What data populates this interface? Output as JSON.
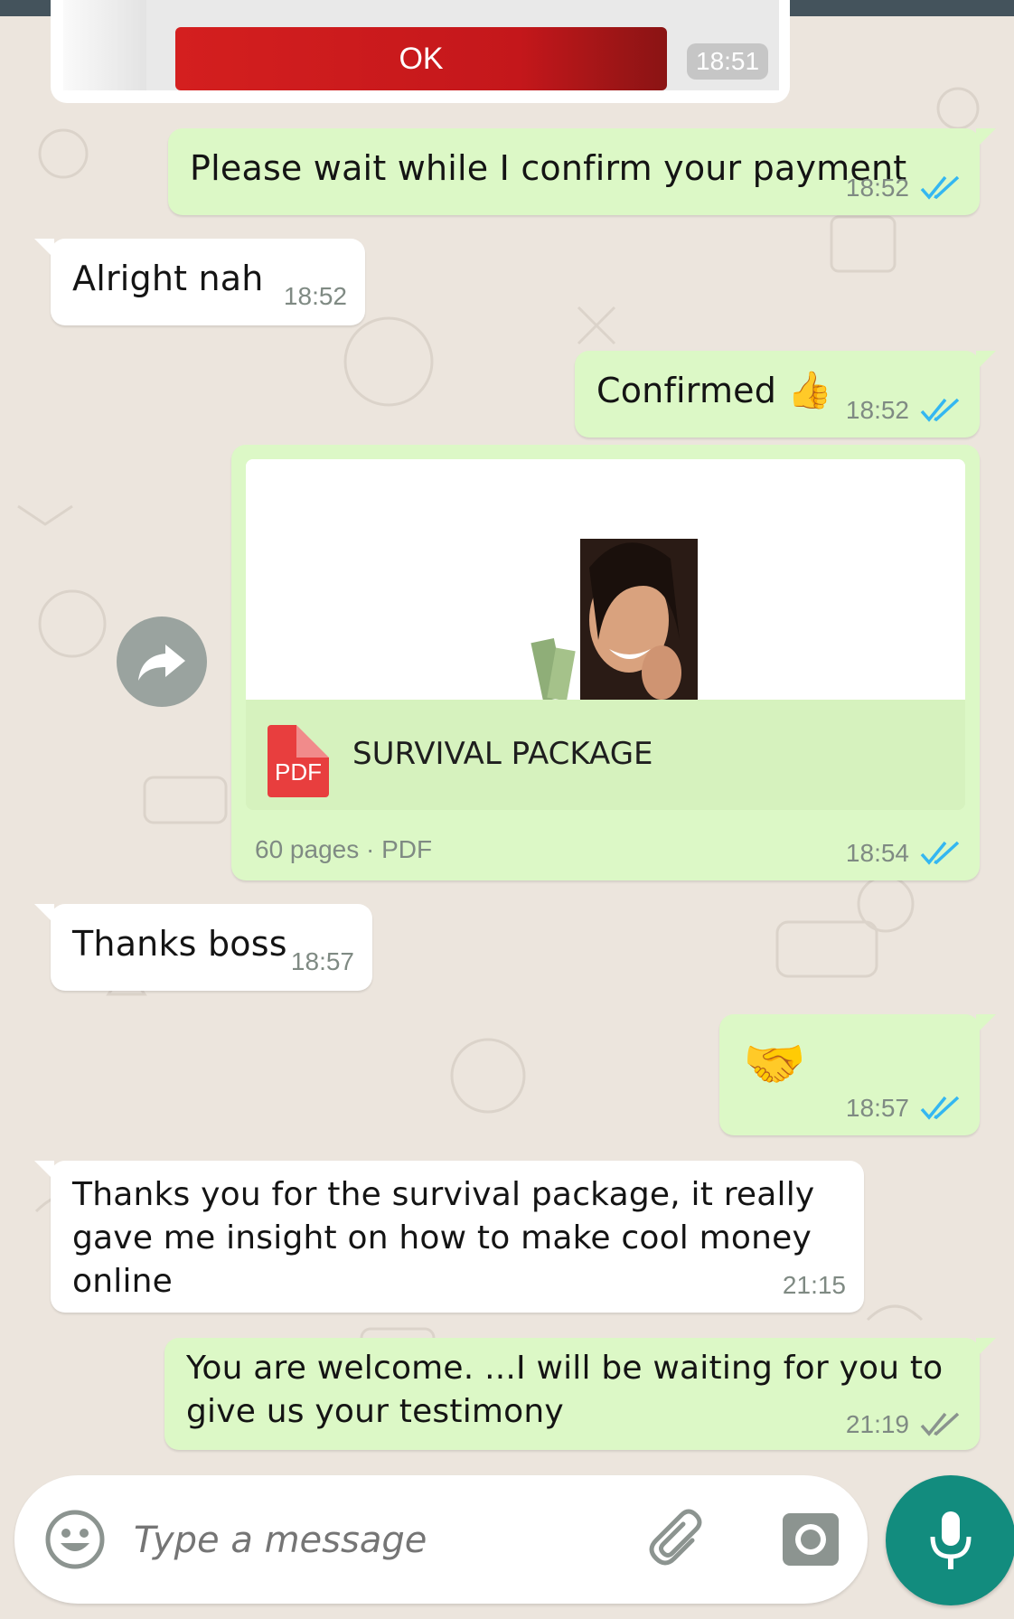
{
  "top_card": {
    "button_label": "OK",
    "time": "18:51"
  },
  "messages": [
    {
      "direction": "out",
      "text": "Please wait while I confirm your payment",
      "time": "18:52",
      "status": "read"
    },
    {
      "direction": "in",
      "text": "Alright nah",
      "time": "18:52"
    },
    {
      "direction": "out",
      "text": "Confirmed",
      "emoji": "👍",
      "time": "18:52",
      "status": "read"
    },
    {
      "direction": "out",
      "type": "document",
      "doc_name": "SURVIVAL PACKAGE",
      "doc_icon_label": "PDF",
      "doc_info": "60 pages · PDF",
      "time": "18:54",
      "status": "read"
    },
    {
      "direction": "in",
      "text": "Thanks boss",
      "time": "18:57"
    },
    {
      "direction": "out",
      "emoji": "🤝",
      "time": "18:57",
      "status": "read"
    },
    {
      "direction": "in",
      "text_lines": [
        "Thanks you for the survival package, it really",
        "gave me insight on how to make cool money online"
      ],
      "time": "21:15"
    },
    {
      "direction": "out",
      "text_lines": [
        "You are welcome. ...I will be waiting for you to",
        "give us your testimony"
      ],
      "time": "21:19",
      "status": "delivered"
    }
  ],
  "composer": {
    "placeholder": "Type a message"
  },
  "colors": {
    "outgoing": "#dcf8c6",
    "incoming": "#ffffff",
    "read_ticks": "#34b7f1",
    "mic": "#128c7e",
    "ok_button": "#d41f1f"
  },
  "icons": [
    "forward-icon",
    "emoji-icon",
    "attach-icon",
    "camera-icon",
    "mic-icon",
    "read-ticks-icon"
  ]
}
